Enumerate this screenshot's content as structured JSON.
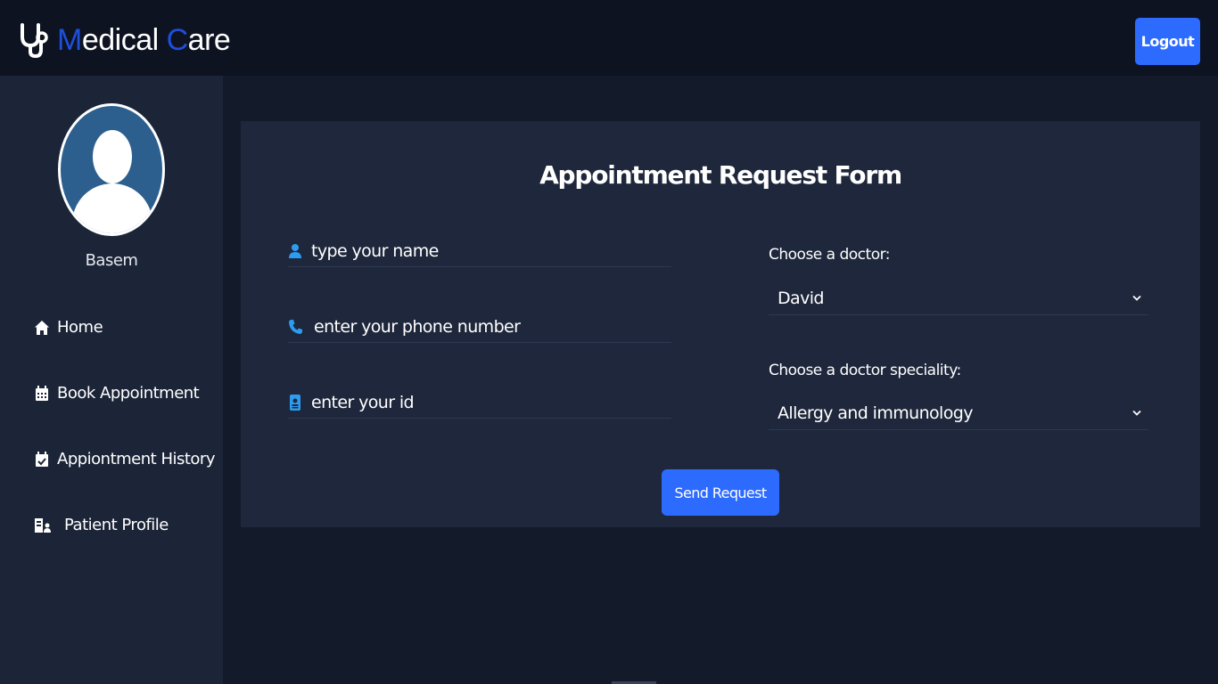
{
  "header": {
    "brand_initial_1": "M",
    "brand_rest_1": "edical ",
    "brand_initial_2": "C",
    "brand_rest_2": "are",
    "logout_label": "Logout",
    "colors": {
      "accent": "#1f4fd9",
      "button": "#2d6bff",
      "bar": "#0d1321"
    }
  },
  "sidebar": {
    "user_name": "Basem",
    "items": [
      {
        "label": "Home",
        "icon": "home-icon"
      },
      {
        "label": "Book Appointment",
        "icon": "calendar-icon"
      },
      {
        "label": "Appiontment History",
        "icon": "calendar-check-icon"
      },
      {
        "label": "Patient Profile",
        "icon": "patient-icon"
      }
    ]
  },
  "form": {
    "title": "Appointment Request Form",
    "name_placeholder": "type your name",
    "phone_placeholder": "enter your phone number",
    "id_placeholder": "enter your id",
    "doctor_label": "Choose a doctor:",
    "doctor_selected": "David",
    "speciality_label": "Choose a doctor speciality:",
    "speciality_selected": "Allergy and immunology",
    "submit_label": "Send Request"
  }
}
